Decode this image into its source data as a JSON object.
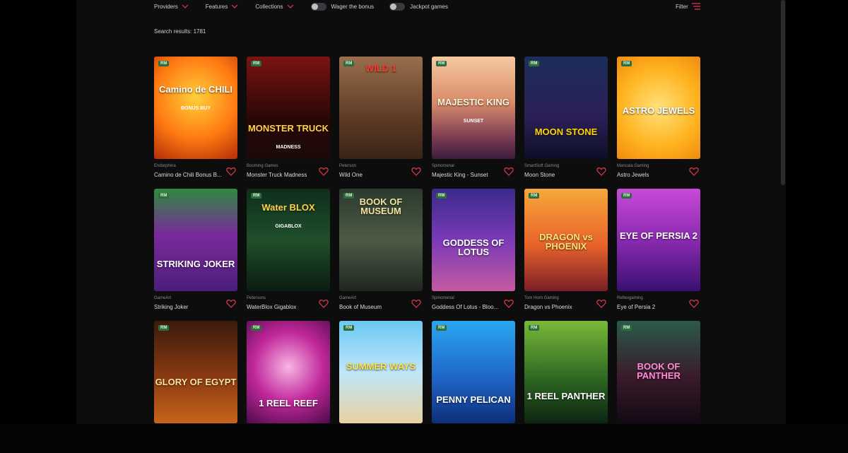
{
  "toolbar": {
    "providers_label": "Providers",
    "features_label": "Features",
    "collections_label": "Collections",
    "wager_bonus_label": "Wager the bonus",
    "jackpot_games_label": "Jackpot games",
    "filter_label": "Filter"
  },
  "search": {
    "results_text": "Search results: 1781"
  },
  "games": [
    {
      "badge": "RM",
      "provider": "Endorphina",
      "name": "Camino de Chili Bonus B...",
      "art": "Camino de CHILI",
      "art_sub": "BONUS BUY"
    },
    {
      "badge": "RM",
      "provider": "Booming Games",
      "name": "Monster Truck Madness",
      "art": "MONSTER TRUCK",
      "art_sub": "MADNESS"
    },
    {
      "badge": "RM",
      "provider": "Peterson",
      "name": "Wild One",
      "art": "WILD 1",
      "art_sub": ""
    },
    {
      "badge": "RM",
      "provider": "Spinomenal",
      "name": "Majestic King - Sunset",
      "art": "MAJESTIC KING",
      "art_sub": "SUNSET"
    },
    {
      "badge": "RM",
      "provider": "SmartSoft Gaming",
      "name": "Moon Stone",
      "art": "MOON STONE",
      "art_sub": ""
    },
    {
      "badge": "RM",
      "provider": "Mancala Gaming",
      "name": "Astro Jewels",
      "art": "ASTRO JEWELS",
      "art_sub": ""
    },
    {
      "badge": "RM",
      "provider": "GameArt",
      "name": "Striking Joker",
      "art": "STRIKING JOKER",
      "art_sub": ""
    },
    {
      "badge": "RM",
      "provider": "Petersons",
      "name": "WaterBlox Gigablox",
      "art": "Water BLOX",
      "art_sub": "GIGABLOX"
    },
    {
      "badge": "RM",
      "provider": "GameArt",
      "name": "Book of Museum",
      "art": "BOOK OF MUSEUM",
      "art_sub": ""
    },
    {
      "badge": "RM",
      "provider": "Spinomenal",
      "name": "Goddess Of Lotus - Bloo...",
      "art": "GODDESS OF LOTUS",
      "art_sub": ""
    },
    {
      "badge": "RM",
      "provider": "Tom Horn Gaming",
      "name": "Dragon vs Phoenix",
      "art": "DRAGON vs PHOENIX",
      "art_sub": ""
    },
    {
      "badge": "RM",
      "provider": "Reflexgaming",
      "name": "Eye of Persia 2",
      "art": "EYE OF PERSIA 2",
      "art_sub": ""
    },
    {
      "badge": "RM",
      "provider": "",
      "name": "",
      "art": "GLORY OF EGYPT",
      "art_sub": ""
    },
    {
      "badge": "RM",
      "provider": "",
      "name": "",
      "art": "1 REEL REEF",
      "art_sub": ""
    },
    {
      "badge": "RM",
      "provider": "",
      "name": "",
      "art": "SUMMER WAYS",
      "art_sub": ""
    },
    {
      "badge": "RM",
      "provider": "",
      "name": "",
      "art": "PENNY PELICAN",
      "art_sub": ""
    },
    {
      "badge": "RM",
      "provider": "",
      "name": "",
      "art": "1 REEL PANTHER",
      "art_sub": ""
    },
    {
      "badge": "RM",
      "provider": "",
      "name": "",
      "art": "BOOK OF PANTHER",
      "art_sub": ""
    }
  ],
  "colors": {
    "background": "#0d0d0e",
    "badge": "#2f6e3c",
    "heart": "#e23a4a",
    "chevron": "#e23a4a"
  },
  "icons": {
    "dropdown": "chevron-down-icon",
    "filter": "filter-lines-icon",
    "favorite": "heart-outline-icon"
  }
}
